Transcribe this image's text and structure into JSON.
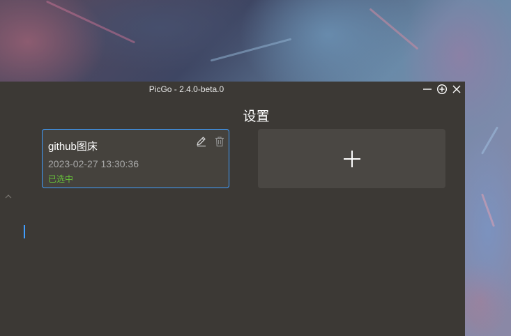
{
  "window": {
    "title": "PicGo - 2.4.0-beta.0",
    "controls": {
      "minimize_icon": "minimize-icon",
      "maximize_icon": "plus-circle-icon",
      "close_icon": "close-icon"
    }
  },
  "page": {
    "title": "设置"
  },
  "config_cards": [
    {
      "name": "github图床",
      "date": "2023-02-27 13:30:36",
      "status": "已选中",
      "selected": true,
      "status_color": "#67c23a",
      "border_color": "#409eff",
      "edit_icon": "pencil-icon",
      "delete_icon": "trash-icon"
    }
  ],
  "add_card": {
    "icon": "plus-icon"
  },
  "colors": {
    "window_bg": "#3c3935",
    "card_bg": "#45423d",
    "accent": "#409eff",
    "status_green": "#67c23a"
  }
}
